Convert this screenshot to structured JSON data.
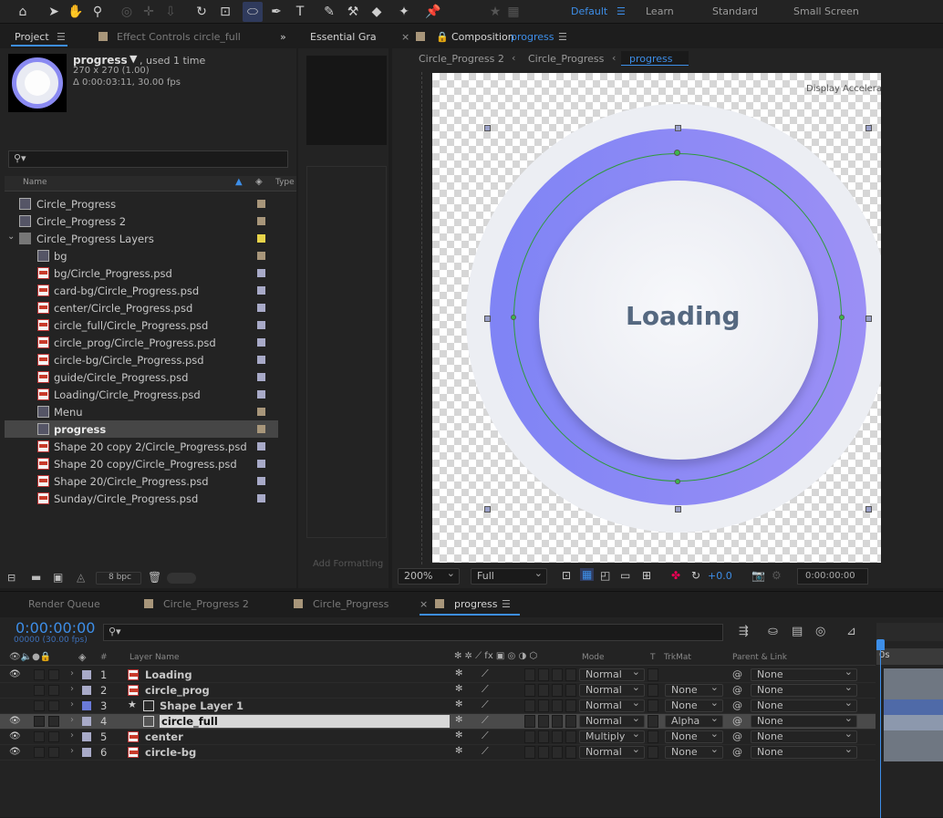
{
  "workspaces": {
    "default": "Default",
    "learn": "Learn",
    "standard": "Standard",
    "small_screen": "Small Screen"
  },
  "project_panel": {
    "tab_project": "Project",
    "tab_effect_controls": "Effect Controls circle_full",
    "selected_name": "progress",
    "used": ", used 1 time",
    "dims": "270 x 270 (1.00)",
    "duration": "Δ 0:00:03:11, 30.00 fps",
    "search_placeholder": "",
    "col_name": "Name",
    "col_type": "Type",
    "bpc": "8 bpc",
    "items": [
      {
        "label": "Circle_Progress",
        "type": "comp",
        "color": "#a8967a"
      },
      {
        "label": "Circle_Progress 2",
        "type": "comp",
        "color": "#a8967a"
      },
      {
        "label": "Circle_Progress Layers",
        "type": "folder",
        "color": "#e8d44a"
      },
      {
        "label": "bg",
        "type": "comp",
        "color": "#a8967a"
      },
      {
        "label": "bg/Circle_Progress.psd",
        "type": "psd",
        "color": "#a8aac8"
      },
      {
        "label": "card-bg/Circle_Progress.psd",
        "type": "psd",
        "color": "#a8aac8"
      },
      {
        "label": "center/Circle_Progress.psd",
        "type": "psd",
        "color": "#a8aac8"
      },
      {
        "label": "circle_full/Circle_Progress.psd",
        "type": "psd",
        "color": "#a8aac8"
      },
      {
        "label": "circle_prog/Circle_Progress.psd",
        "type": "psd",
        "color": "#a8aac8"
      },
      {
        "label": "circle-bg/Circle_Progress.psd",
        "type": "psd",
        "color": "#a8aac8"
      },
      {
        "label": "guide/Circle_Progress.psd",
        "type": "psd",
        "color": "#a8aac8"
      },
      {
        "label": "Loading/Circle_Progress.psd",
        "type": "psd",
        "color": "#a8aac8"
      },
      {
        "label": "Menu",
        "type": "comp",
        "color": "#a8967a"
      },
      {
        "label": "progress",
        "type": "comp",
        "color": "#a8967a",
        "selected": true
      },
      {
        "label": "Shape 20 copy 2/Circle_Progress.psd",
        "type": "psd",
        "color": "#a8aac8"
      },
      {
        "label": "Shape 20 copy/Circle_Progress.psd",
        "type": "psd",
        "color": "#a8aac8"
      },
      {
        "label": "Shape 20/Circle_Progress.psd",
        "type": "psd",
        "color": "#a8aac8"
      },
      {
        "label": "Sunday/Circle_Progress.psd",
        "type": "psd",
        "color": "#a8aac8"
      }
    ]
  },
  "essential_graphics": {
    "tab": "Essential Gra",
    "add_formatting": "Add Formatting"
  },
  "composition": {
    "tab_label": "Composition",
    "tab_name": "progress",
    "breadcrumbs": [
      "Circle_Progress 2",
      "Circle_Progress",
      "progress"
    ],
    "overlay_text": "Display Acceleration Disabled",
    "loading_text": "Loading",
    "zoom": "200%",
    "resolution": "Full",
    "exposure": "+0.0",
    "timecode": "0:00:00:00"
  },
  "timeline": {
    "tabs": [
      "Render Queue",
      "Circle_Progress 2",
      "Circle_Progress",
      "progress"
    ],
    "timecode": "0:00:00:00",
    "frames": "00000 (30.00 fps)",
    "col_layer_name": "Layer Name",
    "col_mode": "Mode",
    "col_t": "T",
    "col_trkmat": "TrkMat",
    "col_parent": "Parent & Link",
    "ruler_label": "0s",
    "layers": [
      {
        "num": "1",
        "name": "Loading",
        "mode": "Normal",
        "trkmat": "",
        "parent": "None",
        "visible": true,
        "color": "#a8aac8",
        "kind": "psd"
      },
      {
        "num": "2",
        "name": "circle_prog",
        "mode": "Normal",
        "trkmat": "None",
        "parent": "None",
        "visible": false,
        "color": "#a8aac8",
        "kind": "psd"
      },
      {
        "num": "3",
        "name": "Shape Layer 1",
        "mode": "Normal",
        "trkmat": "None",
        "parent": "None",
        "visible": false,
        "color": "#6a7ad8",
        "kind": "shape"
      },
      {
        "num": "4",
        "name": "circle_full",
        "mode": "Normal",
        "trkmat": "Alpha",
        "parent": "None",
        "visible": true,
        "color": "#a8aac8",
        "kind": "comp",
        "selected": true
      },
      {
        "num": "5",
        "name": "center",
        "mode": "Multiply",
        "trkmat": "None",
        "parent": "None",
        "visible": true,
        "color": "#a8aac8",
        "kind": "psd"
      },
      {
        "num": "6",
        "name": "circle-bg",
        "mode": "Normal",
        "trkmat": "None",
        "parent": "None",
        "visible": true,
        "color": "#a8aac8",
        "kind": "psd"
      }
    ]
  }
}
